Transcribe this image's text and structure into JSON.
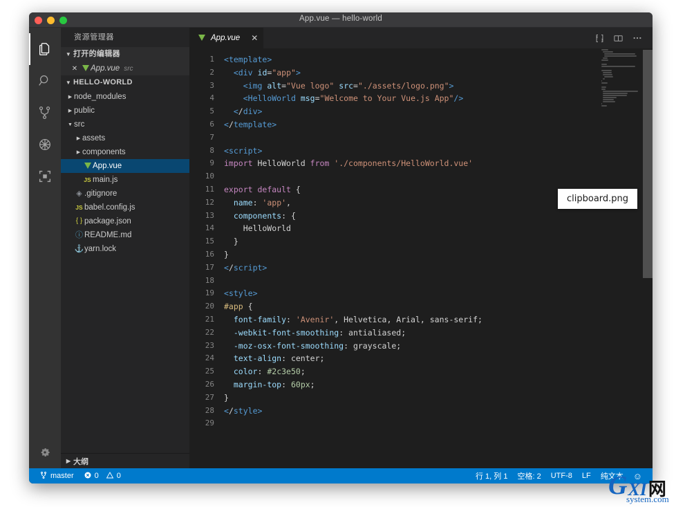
{
  "window": {
    "title": "App.vue — hello-world",
    "traffic_lights": [
      "close",
      "minimize",
      "maximize"
    ]
  },
  "activity_bar": {
    "items": [
      {
        "name": "explorer",
        "icon": "files-icon",
        "active": true
      },
      {
        "name": "search",
        "icon": "search-icon",
        "active": false
      },
      {
        "name": "source-control",
        "icon": "source-control-icon",
        "active": false
      },
      {
        "name": "run-and-debug",
        "icon": "debug-icon",
        "active": false
      },
      {
        "name": "extensions",
        "icon": "extensions-icon",
        "active": false
      }
    ],
    "manage": {
      "name": "manage",
      "icon": "gear-icon"
    }
  },
  "sidebar": {
    "title": "资源管理器",
    "open_editors": {
      "label": "打开的编辑器",
      "expanded": true,
      "items": [
        {
          "close": "✕",
          "icon": "vue-icon",
          "name": "App.vue",
          "sub": "src"
        }
      ]
    },
    "workspace": {
      "label": "HELLO-WORLD",
      "expanded": true,
      "items": [
        {
          "name": "node_modules",
          "type": "folder",
          "arrow": "▶",
          "indent": 1,
          "icon": "folder-icon",
          "selected": false
        },
        {
          "name": "public",
          "type": "folder",
          "arrow": "▶",
          "indent": 1,
          "icon": "folder-icon",
          "selected": false
        },
        {
          "name": "src",
          "type": "folder",
          "arrow": "▼",
          "indent": 1,
          "icon": "folder-icon",
          "selected": false
        },
        {
          "name": "assets",
          "type": "folder",
          "arrow": "▶",
          "indent": 2,
          "icon": "folder-icon",
          "selected": false
        },
        {
          "name": "components",
          "type": "folder",
          "arrow": "▶",
          "indent": 2,
          "icon": "folder-icon",
          "selected": false
        },
        {
          "name": "App.vue",
          "type": "file",
          "arrow": "",
          "indent": 2,
          "icon": "vue-icon",
          "selected": true
        },
        {
          "name": "main.js",
          "type": "file",
          "arrow": "",
          "indent": 2,
          "icon": "js-icon",
          "selected": false
        },
        {
          "name": ".gitignore",
          "type": "file",
          "arrow": "",
          "indent": 1,
          "icon": "git-icon",
          "selected": false
        },
        {
          "name": "babel.config.js",
          "type": "file",
          "arrow": "",
          "indent": 1,
          "icon": "js-icon",
          "selected": false
        },
        {
          "name": "package.json",
          "type": "file",
          "arrow": "",
          "indent": 1,
          "icon": "json-icon",
          "selected": false
        },
        {
          "name": "README.md",
          "type": "file",
          "arrow": "",
          "indent": 1,
          "icon": "md-icon",
          "selected": false
        },
        {
          "name": "yarn.lock",
          "type": "file",
          "arrow": "",
          "indent": 1,
          "icon": "lock-icon",
          "selected": false
        }
      ]
    },
    "outline": {
      "label": "大纲",
      "expanded": false
    }
  },
  "editor": {
    "tabs": [
      {
        "label": "App.vue",
        "icon": "vue-icon",
        "active": true,
        "close": "✕",
        "dirty": false
      }
    ],
    "actions": [
      {
        "name": "split-editor",
        "icon": "split-editor-icon"
      },
      {
        "name": "toggle-layout",
        "icon": "layout-icon"
      },
      {
        "name": "more-actions",
        "icon": "more-icon"
      }
    ],
    "line_numbers": [
      "1",
      "2",
      "3",
      "4",
      "5",
      "6",
      "7",
      "8",
      "9",
      "10",
      "11",
      "12",
      "13",
      "14",
      "15",
      "16",
      "17",
      "18",
      "19",
      "20",
      "21",
      "22",
      "23",
      "24",
      "25",
      "26",
      "27",
      "28",
      "29"
    ],
    "lines": [
      "<template>",
      "  <div id=\"app\">",
      "    <img alt=\"Vue logo\" src=\"./assets/logo.png\">",
      "    <HelloWorld msg=\"Welcome to Your Vue.js App\"/>",
      "  </div>",
      "</template>",
      "",
      "<script>",
      "import HelloWorld from './components/HelloWorld.vue'",
      "",
      "export default {",
      "  name: 'app',",
      "  components: {",
      "    HelloWorld",
      "  }",
      "}",
      "</script>",
      "",
      "<style>",
      "#app {",
      "  font-family: 'Avenir', Helvetica, Arial, sans-serif;",
      "  -webkit-font-smoothing: antialiased;",
      "  -moz-osx-font-smoothing: grayscale;",
      "  text-align: center;",
      "  color: #2c3e50;",
      "  margin-top: 60px;",
      "}",
      "</style>",
      ""
    ]
  },
  "status_bar": {
    "left": [
      {
        "name": "branch",
        "icon": "source-control-icon",
        "label": "master"
      },
      {
        "name": "errors",
        "icon": "error-icon",
        "label": "0"
      },
      {
        "name": "warnings",
        "icon": "warning-icon",
        "label": "0"
      }
    ],
    "right": [
      {
        "name": "cursor-position",
        "label": "行 1, 列 1"
      },
      {
        "name": "indentation",
        "label": "空格: 2"
      },
      {
        "name": "encoding",
        "label": "UTF-8"
      },
      {
        "name": "eol",
        "label": "LF"
      },
      {
        "name": "language-mode",
        "label": "纯文本"
      },
      {
        "name": "feedback",
        "label": "☺"
      }
    ]
  },
  "overlay": {
    "clipboard_tooltip": "clipboard.png"
  },
  "watermark": {
    "g": "G",
    "xi": "XI",
    "cn": "网",
    "domain": "system.com"
  },
  "colors": {
    "accent": "#007acc",
    "selection": "#094771",
    "editor_bg": "#1e1e1e",
    "sidebar_bg": "#252526",
    "activitybar_bg": "#333333",
    "titlebar_bg": "#3a3a3c",
    "vue_green": "#7ab648"
  }
}
